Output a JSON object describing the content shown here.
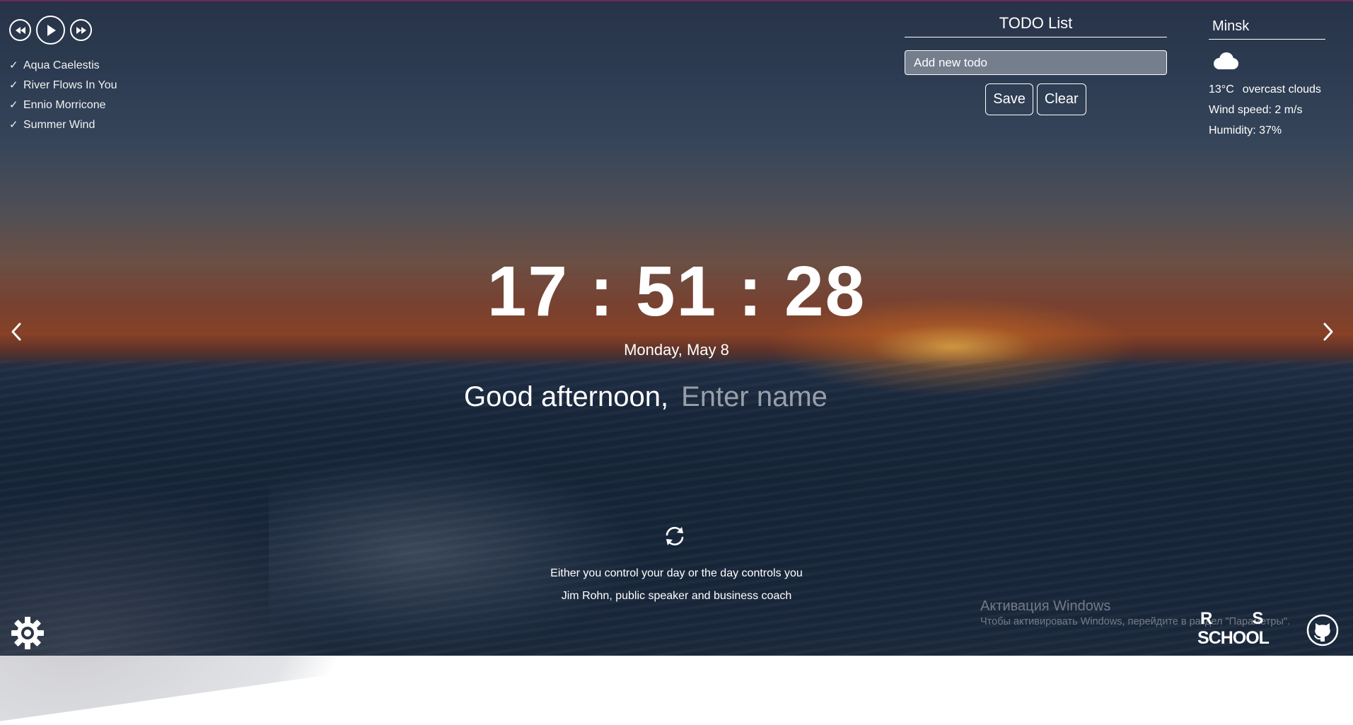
{
  "player": {
    "tracks": [
      {
        "title": "Aqua Caelestis"
      },
      {
        "title": "River Flows In You"
      },
      {
        "title": "Ennio Morricone"
      },
      {
        "title": "Summer Wind"
      }
    ],
    "check_glyph": "✓"
  },
  "todo": {
    "title": "TODO List",
    "placeholder": "Add new todo",
    "save_label": "Save",
    "clear_label": "Clear"
  },
  "weather": {
    "city": "Minsk",
    "icon": "cloud-icon",
    "temperature": "13°C",
    "description": "overcast clouds",
    "wind": "Wind speed: 2 m/s",
    "humidity": "Humidity: 37%"
  },
  "clock": {
    "time": "17 : 51 : 28",
    "date": "Monday, May 8"
  },
  "greeting": {
    "text": "Good afternoon,",
    "name_placeholder": "Enter name"
  },
  "quote": {
    "text": "Either you control your day or the day controls you",
    "author": "Jim Rohn, public speaker and business coach"
  },
  "watermark": {
    "title": "Активация Windows",
    "text": "Чтобы активировать Windows, перейдите в раздел \"Параметры\"."
  },
  "logo": {
    "top": "RS",
    "bottom": "SCHOOL"
  },
  "colors": {
    "text": "#ffffff",
    "top_border": "#6a2a5a"
  }
}
